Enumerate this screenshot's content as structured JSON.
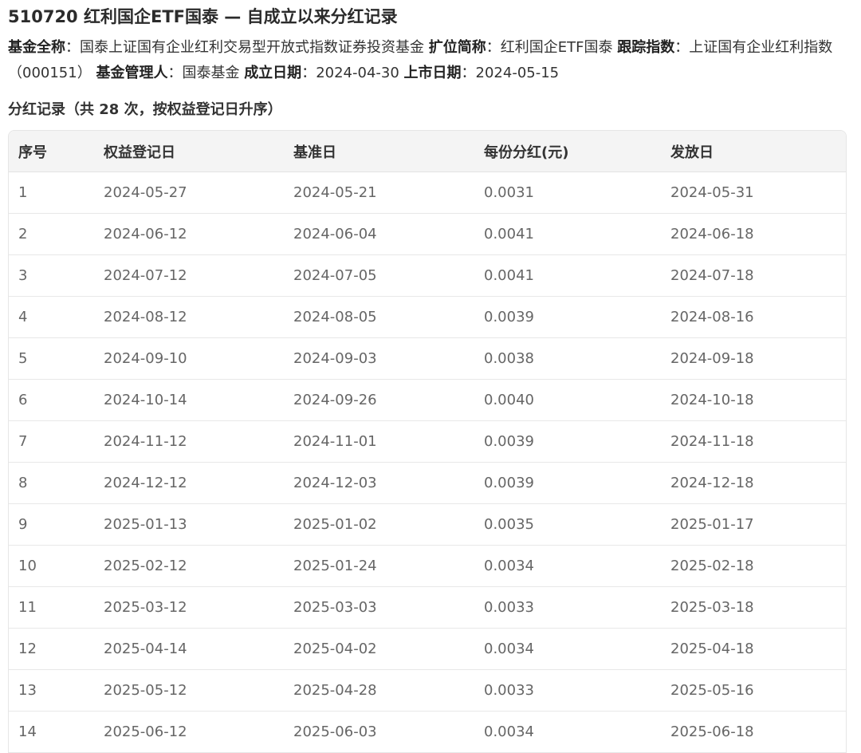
{
  "title": "510720 红利国企ETF国泰 — 自成立以来分红记录",
  "info": {
    "full_name_label": "基金全称",
    "full_name": "国泰上证国有企业红利交易型开放式指数证券投资基金",
    "short_name_label": "扩位简称",
    "short_name": "红利国企ETF国泰",
    "index_label": "跟踪指数",
    "index": "上证国有企业红利指数（000151）",
    "manager_label": "基金管理人",
    "manager": "国泰基金",
    "inception_label": "成立日期",
    "inception": "2024-04-30",
    "listing_label": "上市日期",
    "listing": "2024-05-15",
    "sep": "："
  },
  "section_title": "分红记录（共 28 次，按权益登记日升序）",
  "table": {
    "headers": [
      "序号",
      "权益登记日",
      "基准日",
      "每份分红(元)",
      "发放日"
    ],
    "rows": [
      [
        "1",
        "2024-05-27",
        "2024-05-21",
        "0.0031",
        "2024-05-31"
      ],
      [
        "2",
        "2024-06-12",
        "2024-06-04",
        "0.0041",
        "2024-06-18"
      ],
      [
        "3",
        "2024-07-12",
        "2024-07-05",
        "0.0041",
        "2024-07-18"
      ],
      [
        "4",
        "2024-08-12",
        "2024-08-05",
        "0.0039",
        "2024-08-16"
      ],
      [
        "5",
        "2024-09-10",
        "2024-09-03",
        "0.0038",
        "2024-09-18"
      ],
      [
        "6",
        "2024-10-14",
        "2024-09-26",
        "0.0040",
        "2024-10-18"
      ],
      [
        "7",
        "2024-11-12",
        "2024-11-01",
        "0.0039",
        "2024-11-18"
      ],
      [
        "8",
        "2024-12-12",
        "2024-12-03",
        "0.0039",
        "2024-12-18"
      ],
      [
        "9",
        "2025-01-13",
        "2025-01-02",
        "0.0035",
        "2025-01-17"
      ],
      [
        "10",
        "2025-02-12",
        "2025-01-24",
        "0.0034",
        "2025-02-18"
      ],
      [
        "11",
        "2025-03-12",
        "2025-03-03",
        "0.0033",
        "2025-03-18"
      ],
      [
        "12",
        "2025-04-14",
        "2025-04-02",
        "0.0034",
        "2025-04-18"
      ],
      [
        "13",
        "2025-05-12",
        "2025-04-28",
        "0.0033",
        "2025-05-16"
      ],
      [
        "14",
        "2025-06-12",
        "2025-06-03",
        "0.0034",
        "2025-06-18"
      ]
    ]
  }
}
